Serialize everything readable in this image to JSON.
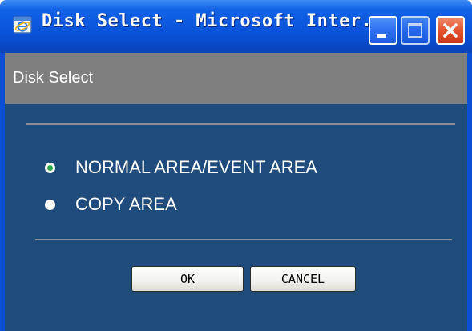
{
  "window": {
    "title": "Disk Select - Microsoft Inter...",
    "icon": "internet-explorer-icon",
    "controls": [
      "minimize-icon",
      "maximize-icon",
      "close-icon"
    ]
  },
  "panel": {
    "header": "Disk Select"
  },
  "options": [
    {
      "label": "NORMAL AREA/EVENT AREA",
      "selected": true
    },
    {
      "label": "COPY AREA",
      "selected": false
    }
  ],
  "buttons": {
    "ok_label": "OK",
    "cancel_label": "CANCEL"
  },
  "colors": {
    "title_bar": "#0a55dc",
    "header_bar": "#7f7f7f",
    "panel_background": "#1f4c7d",
    "selected_radio": "#27a844"
  }
}
